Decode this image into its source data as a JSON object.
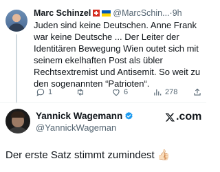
{
  "reply_tweet": {
    "author_name": "Marc Schinzel",
    "flags": [
      "switzerland-flag",
      "ukraine-flag"
    ],
    "handle": "@MarcSchin...",
    "separator": "·",
    "time": "9h",
    "text_lines": [
      "Juden sind keine Deutschen. Anne Frank",
      "war keine Deutsche ... Der Leiter der",
      "Identitären Bewegung Wien outet sich mit",
      "seinem ekelhaften Post als übler",
      "Rechtsextremist und Antisemit. So weit zu",
      "den sogenannten “Patrioten“."
    ],
    "actions": {
      "reply_count": "1",
      "retweet_count": "",
      "like_count": "6",
      "views_count": "278"
    }
  },
  "main_tweet": {
    "author_name": "Yannick Wagemann",
    "verified": true,
    "handle": "@YannickWageman",
    "text": "Der erste Satz stimmt zumindest",
    "emoji": "👍🏻"
  },
  "branding": {
    "logo_suffix": ".com"
  },
  "colors": {
    "text_primary": "#0f1419",
    "text_secondary": "#536471",
    "verified_blue": "#1d9bf0",
    "divider": "#eff3f4"
  }
}
